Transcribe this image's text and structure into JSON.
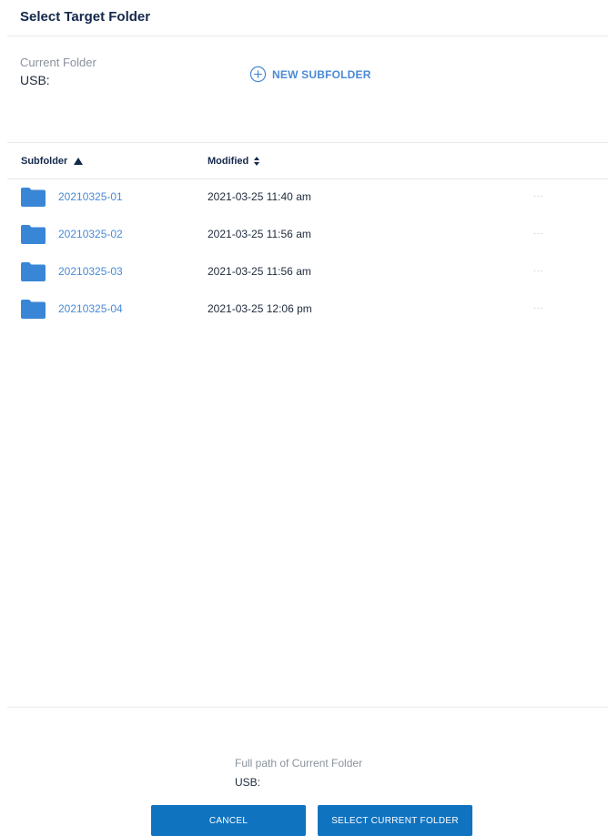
{
  "dialog": {
    "title": "Select Target Folder"
  },
  "current_folder": {
    "label": "Current Folder",
    "value": "USB:"
  },
  "new_subfolder": {
    "label": "NEW SUBFOLDER",
    "icon": "plus-circle-icon"
  },
  "table": {
    "columns": [
      {
        "label": "Subfolder",
        "sort": "ascending"
      },
      {
        "label": "Modified",
        "sort": "none"
      }
    ],
    "rows": [
      {
        "name": "20210325-01",
        "modified": "2021-03-25 11:40 am",
        "more": "..."
      },
      {
        "name": "20210325-02",
        "modified": "2021-03-25 11:56 am",
        "more": "..."
      },
      {
        "name": "20210325-03",
        "modified": "2021-03-25 11:56 am",
        "more": "..."
      },
      {
        "name": "20210325-04",
        "modified": "2021-03-25 12:06 pm",
        "more": "..."
      }
    ]
  },
  "footer": {
    "path_label": "Full path of Current Folder",
    "path_value": "USB:",
    "cancel_label": "CANCEL",
    "select_label": "SELECT CURRENT FOLDER"
  },
  "colors": {
    "accent": "#4a8ad6",
    "button": "#0f73c0",
    "title": "#14284b"
  }
}
